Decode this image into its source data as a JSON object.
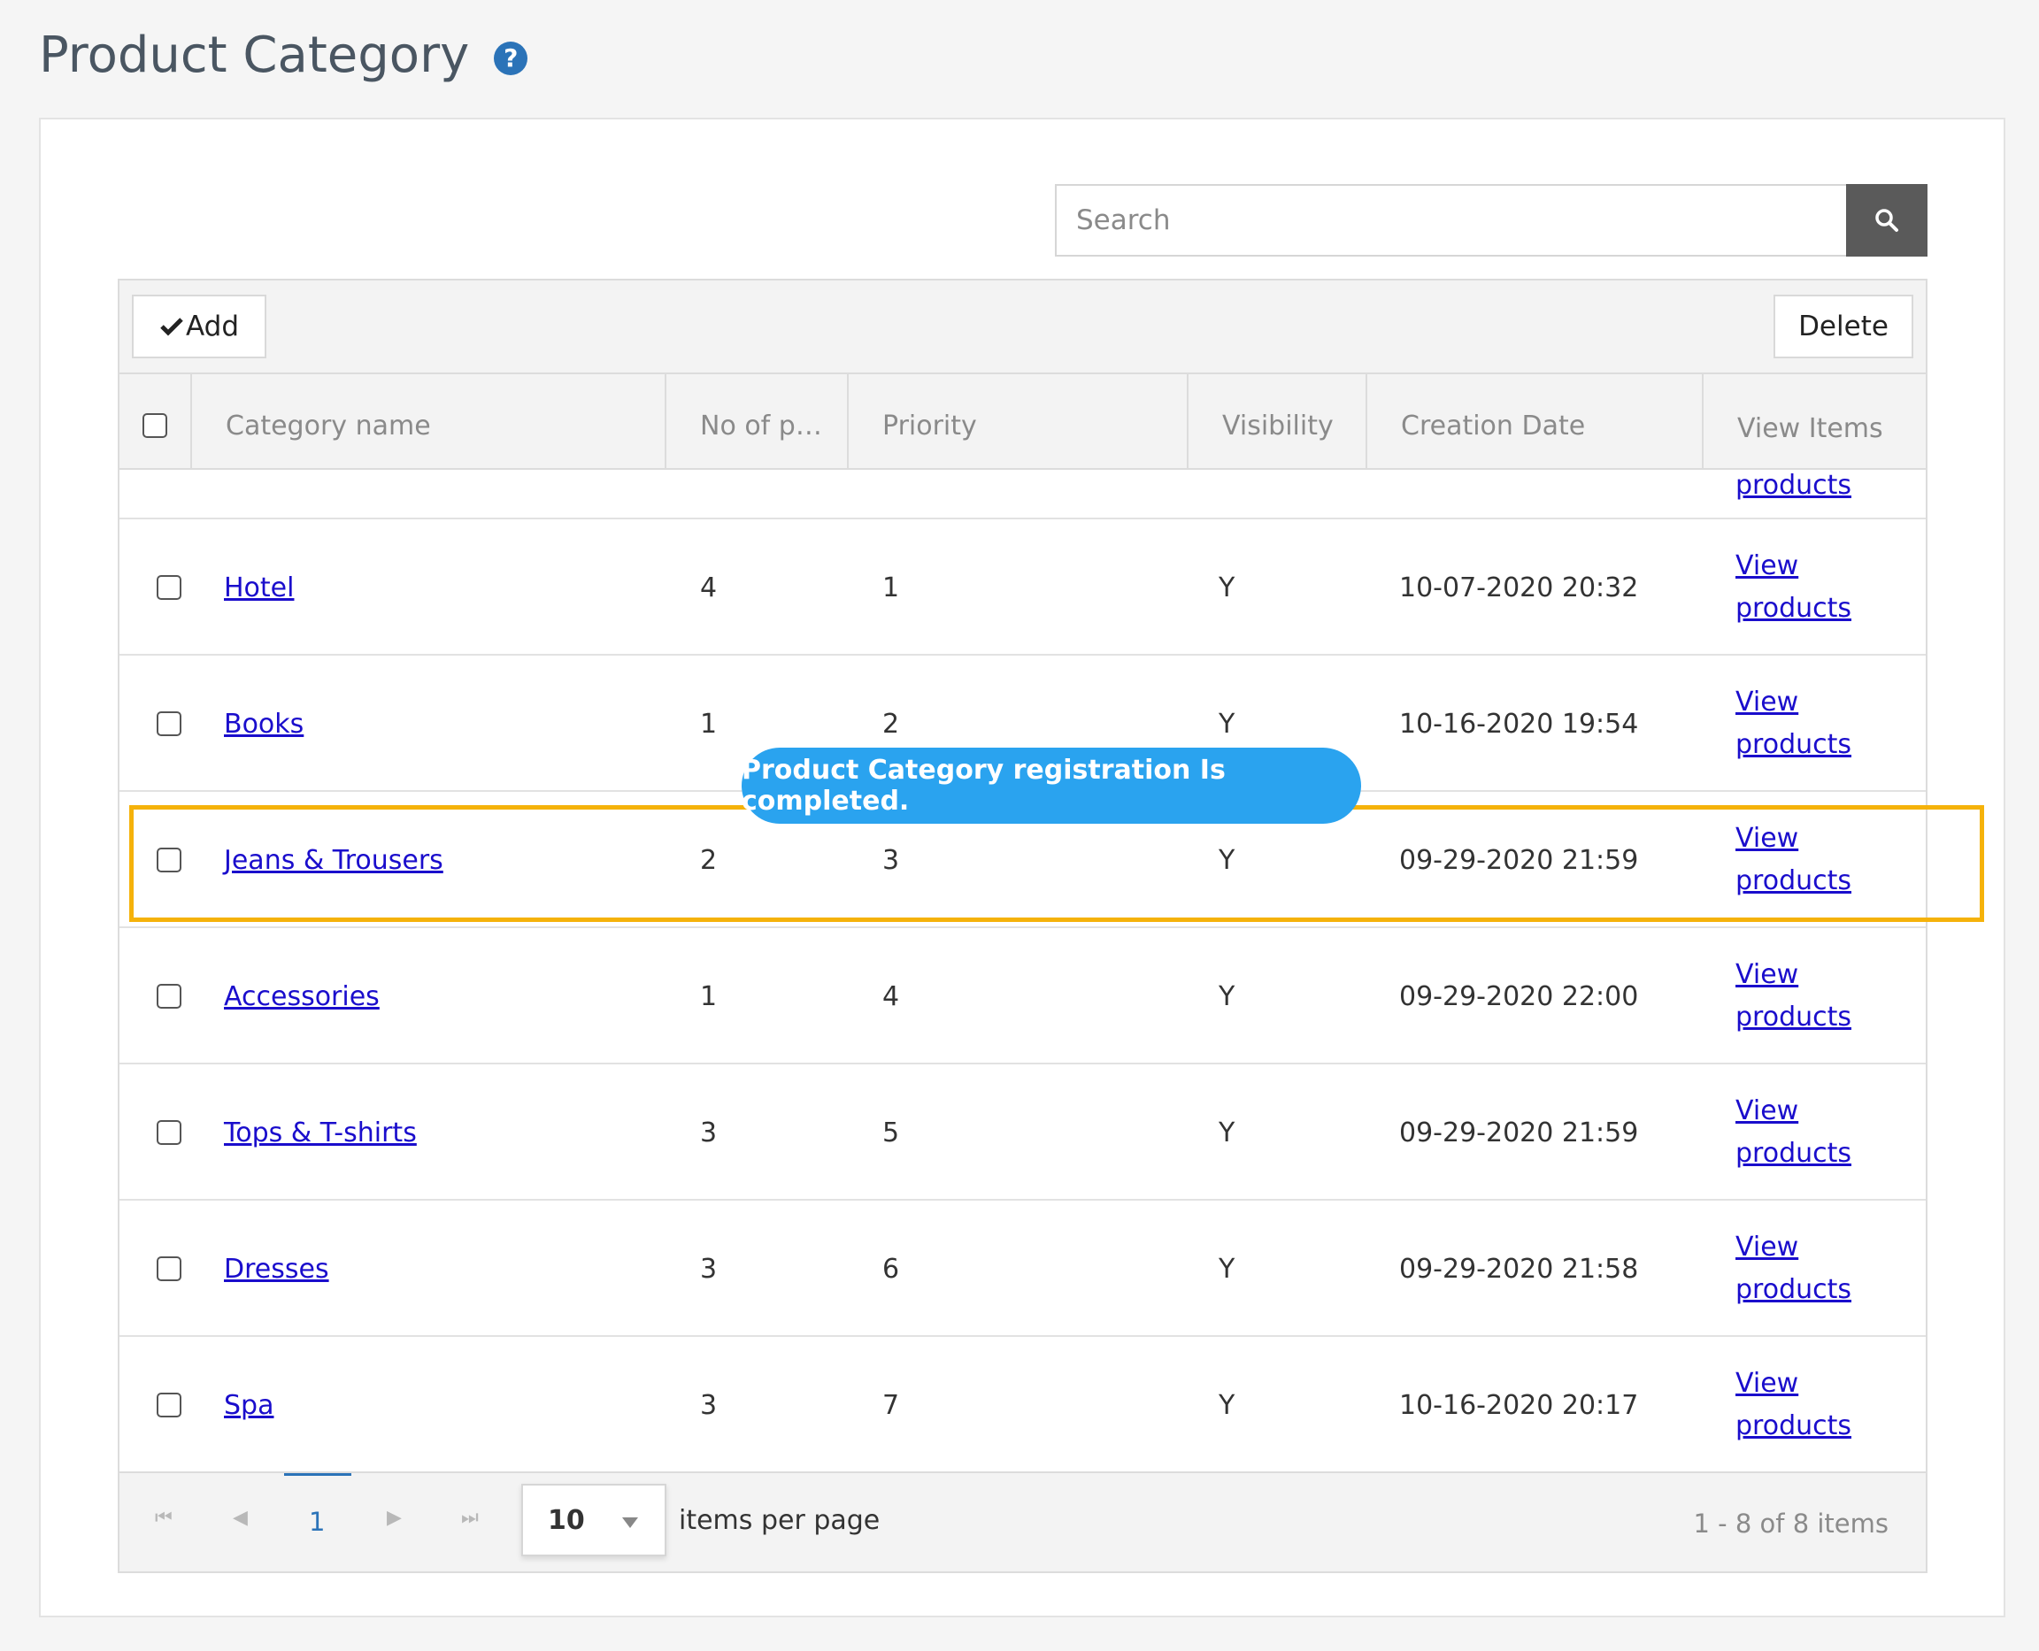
{
  "page": {
    "title": "Product Category",
    "help_icon": "question-circle-icon"
  },
  "search": {
    "placeholder": "Search",
    "icon": "search-icon"
  },
  "toolbar": {
    "add_label": "Add",
    "add_icon": "check-icon",
    "delete_label": "Delete"
  },
  "table": {
    "columns": [
      "Category name",
      "No of p…",
      "Priority",
      "Visibility",
      "Creation Date",
      "View Items"
    ],
    "partial_row_link": "products",
    "rows": [
      {
        "name": "Hotel",
        "count": "4",
        "priority": "1",
        "visibility": "Y",
        "date": "10-07-2020 20:32",
        "view_line1": "View",
        "view_line2": "products"
      },
      {
        "name": "Books",
        "count": "1",
        "priority": "2",
        "visibility": "Y",
        "date": "10-16-2020 19:54",
        "view_line1": "View",
        "view_line2": "products"
      },
      {
        "name": "Jeans & Trousers",
        "count": "2",
        "priority": "3",
        "visibility": "Y",
        "date": "09-29-2020 21:59",
        "view_line1": "View",
        "view_line2": "products"
      },
      {
        "name": "Accessories",
        "count": "1",
        "priority": "4",
        "visibility": "Y",
        "date": "09-29-2020 22:00",
        "view_line1": "View",
        "view_line2": "products"
      },
      {
        "name": "Tops & T-shirts",
        "count": "3",
        "priority": "5",
        "visibility": "Y",
        "date": "09-29-2020 21:59",
        "view_line1": "View",
        "view_line2": "products"
      },
      {
        "name": "Dresses",
        "count": "3",
        "priority": "6",
        "visibility": "Y",
        "date": "09-29-2020 21:58",
        "view_line1": "View",
        "view_line2": "products"
      },
      {
        "name": "Spa",
        "count": "3",
        "priority": "7",
        "visibility": "Y",
        "date": "10-16-2020 20:17",
        "view_line1": "View",
        "view_line2": "products"
      }
    ]
  },
  "toast": {
    "message": "Product Category registration Is completed."
  },
  "pager": {
    "current_page": "1",
    "page_size": "10",
    "page_size_label": "items per page",
    "info": "1 - 8 of 8 items"
  },
  "colors": {
    "link": "#1a0dcc",
    "highlight": "#f5b20a",
    "toast": "#2aa3ef",
    "accent": "#2b73b8"
  }
}
